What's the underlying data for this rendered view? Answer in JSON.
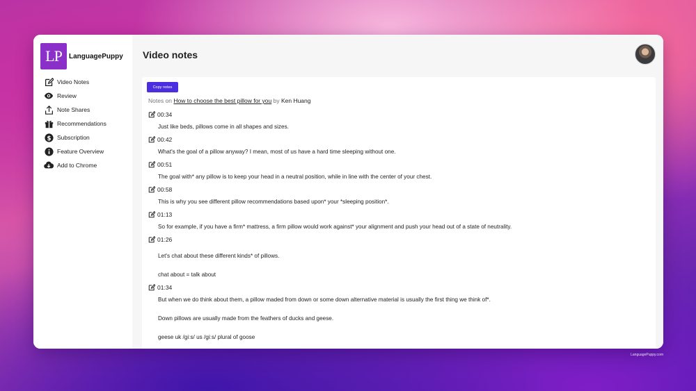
{
  "app": {
    "brand": "LanguagePuppy",
    "logo_text": "LP",
    "footer": "LanguagePuppy.com"
  },
  "sidebar": {
    "items": [
      {
        "label": "Video Notes",
        "icon": "edit-icon"
      },
      {
        "label": "Review",
        "icon": "eye-icon"
      },
      {
        "label": "Note Shares",
        "icon": "share-icon"
      },
      {
        "label": "Recommendations",
        "icon": "gift-icon"
      },
      {
        "label": "Subscription",
        "icon": "dollar-icon"
      },
      {
        "label": "Feature Overview",
        "icon": "info-icon"
      },
      {
        "label": "Add to Chrome",
        "icon": "download-icon"
      }
    ]
  },
  "header": {
    "title": "Video notes"
  },
  "notes": {
    "copy_label": "Copy notes",
    "prefix": "Notes on",
    "video_title": "How to choose the best pillow for you",
    "by": "by",
    "author": "Ken Huang",
    "entries": [
      {
        "time": "00:34",
        "lines": [
          "Just like beds, pillows come in all shapes and sizes."
        ]
      },
      {
        "time": "00:42",
        "lines": [
          "What's the goal of a pillow anyway? I mean, most of us have a hard time sleeping without one."
        ]
      },
      {
        "time": "00:51",
        "lines": [
          "The goal with* any pillow is to keep your head in a neutral position, while in line with the center of your chest."
        ]
      },
      {
        "time": "00:58",
        "lines": [
          "This is why you see different pillow recommendations based upon* your *sleeping position*."
        ]
      },
      {
        "time": "01:13",
        "lines": [
          "So for example, if you have a firm* mattress, a firm pillow would work against* your alignment and push your head out of a state of neutrality."
        ]
      },
      {
        "time": "01:26",
        "lines": [
          "Let's chat about these different kinds* of pillows.",
          "chat about = talk about"
        ]
      },
      {
        "time": "01:34",
        "lines": [
          "But when we do think about them, a pillow maded from down or some down alternative material is usually the first thing we think of*.",
          "Down pillows are usually made from the feathers of ducks and geese.",
          "geese uk /ɡiːs/ us /ɡiːs/ plural of goose"
        ]
      }
    ]
  },
  "colors": {
    "brand": "#8b2fc9",
    "button": "#4a2ee0"
  }
}
